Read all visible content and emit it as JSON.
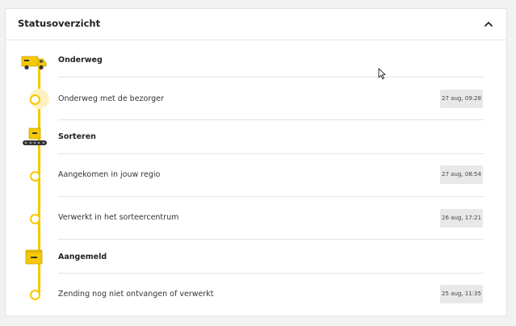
{
  "panel": {
    "title": "Statusoverzicht",
    "collapse_icon": "chevron-up-icon"
  },
  "timeline": {
    "accent_color": "#f5c800",
    "groups": [
      {
        "label": "Onderweg",
        "icon": "delivery-van-icon",
        "events": [
          {
            "label": "Onderweg met de bezorger",
            "timestamp": "27 aug, 09:28",
            "current": true
          }
        ]
      },
      {
        "label": "Sorteren",
        "icon": "conveyor-package-icon",
        "events": [
          {
            "label": "Aangekomen in jouw regio",
            "timestamp": "27 aug, 08:54",
            "current": false
          },
          {
            "label": "Verwerkt in het sorteercentrum",
            "timestamp": "26 aug, 17:21",
            "current": false
          }
        ]
      },
      {
        "label": "Aangemeld",
        "icon": "package-icon",
        "events": [
          {
            "label": "Zending nog niet ontvangen of verwerkt",
            "timestamp": "25 aug, 11:35",
            "current": false
          }
        ]
      }
    ]
  }
}
